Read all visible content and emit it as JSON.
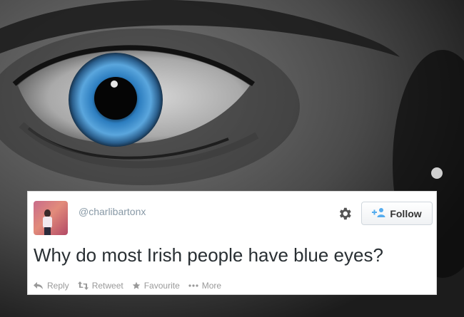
{
  "tweet": {
    "username": "@charlibartonx",
    "text": "Why do most Irish people have blue eyes?",
    "follow_label": "Follow",
    "actions": {
      "reply": "Reply",
      "retweet": "Retweet",
      "favourite": "Favourite",
      "more": "More"
    }
  },
  "icons": {
    "settings": "gear-icon",
    "follow": "add-user-icon",
    "reply": "reply-arrow-icon",
    "retweet": "retweet-icon",
    "favourite": "star-icon",
    "more": "ellipsis-icon"
  },
  "colors": {
    "follow_icon": "#55acee",
    "action_text": "#999999",
    "username": "#8899a6",
    "tweet_text": "#292f33",
    "iris": "#3a7fc0"
  }
}
